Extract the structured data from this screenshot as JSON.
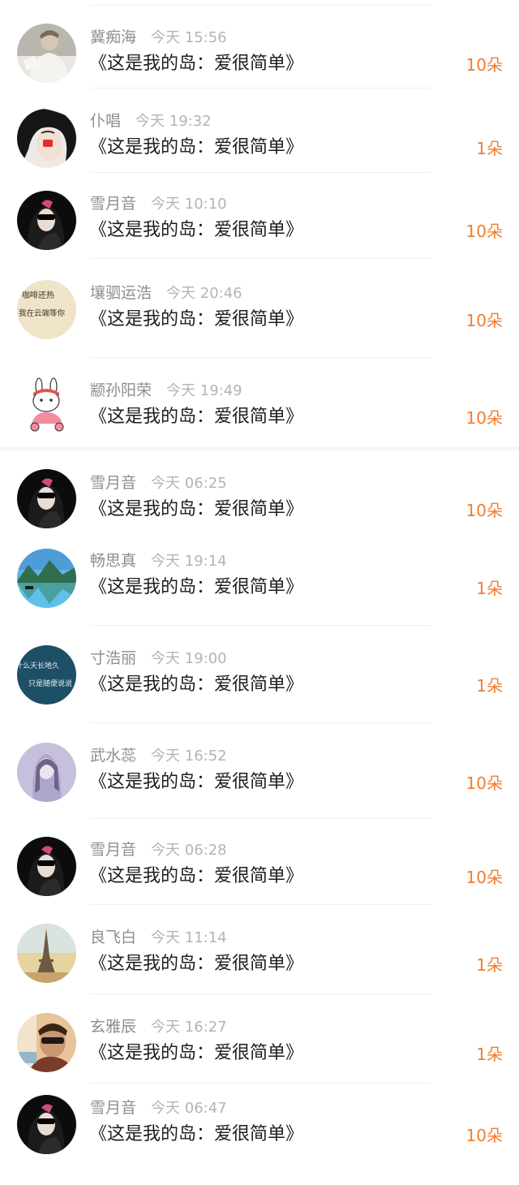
{
  "entries": [
    {
      "name": "冀痴海",
      "time": "今天 15:56",
      "title": "《这是我的岛：爱很简单》",
      "amount": "10朵",
      "avatar": "photo-person-white-outfit-icon"
    },
    {
      "name": "仆唱",
      "time": "今天 19:32",
      "title": "《这是我的岛：爱很简单》",
      "amount": "1朵",
      "avatar": "photo-person-red-patch-icon"
    },
    {
      "name": "雪月音",
      "time": "今天 10:10",
      "title": "《这是我的岛：爱很简单》",
      "amount": "10朵",
      "avatar": "photo-person-sunglasses-icon"
    },
    {
      "name": "壤驷运浩",
      "time": "今天 20:46",
      "title": "《这是我的岛：爱很简单》",
      "amount": "10朵",
      "avatar": "text-art-avatar-icon",
      "avatar_text": [
        "咖啡还热",
        "我在云端等你"
      ]
    },
    {
      "name": "颛孙阳荣",
      "time": "今天 19:49",
      "title": "《这是我的岛：爱很简单》",
      "amount": "10朵",
      "avatar": "cartoon-rabbit-scooter-icon"
    },
    {
      "name": "雪月音",
      "time": "今天 06:25",
      "title": "《这是我的岛：爱很简单》",
      "amount": "10朵",
      "avatar": "photo-person-sunglasses-icon"
    },
    {
      "name": "畅思真",
      "time": "今天 19:14",
      "title": "《这是我的岛：爱很简单》",
      "amount": "1朵",
      "avatar": "photo-mountain-lake-icon"
    },
    {
      "name": "寸浩丽",
      "time": "今天 19:00",
      "title": "《这是我的岛：爱很简单》",
      "amount": "1朵",
      "avatar": "text-art-dark-blue-icon",
      "avatar_text": [
        "什么天长地久",
        "只是随便说说"
      ]
    },
    {
      "name": "武水蕊",
      "time": "今天 16:52",
      "title": "《这是我的岛：爱很简单》",
      "amount": "10朵",
      "avatar": "illustration-girl-purple-icon"
    },
    {
      "name": "雪月音",
      "time": "今天 06:28",
      "title": "《这是我的岛：爱很简单》",
      "amount": "10朵",
      "avatar": "photo-person-sunglasses-icon"
    },
    {
      "name": "良飞白",
      "time": "今天 11:14",
      "title": "《这是我的岛：爱很简单》",
      "amount": "1朵",
      "avatar": "photo-eiffel-tower-icon"
    },
    {
      "name": "玄雅辰",
      "time": "今天 16:27",
      "title": "《这是我的岛：爱很简单》",
      "amount": "1朵",
      "avatar": "photo-person-sunglasses-warm-icon"
    },
    {
      "name": "雪月音",
      "time": "今天 06:47",
      "title": "《这是我的岛：爱很简单》",
      "amount": "10朵",
      "avatar": "photo-person-sunglasses-icon"
    }
  ],
  "colors": {
    "name": "#8e8e8e",
    "time": "#b4b4b4",
    "title": "#1d1d1d",
    "amount": "#f07d2e",
    "divider": "#efefef"
  }
}
